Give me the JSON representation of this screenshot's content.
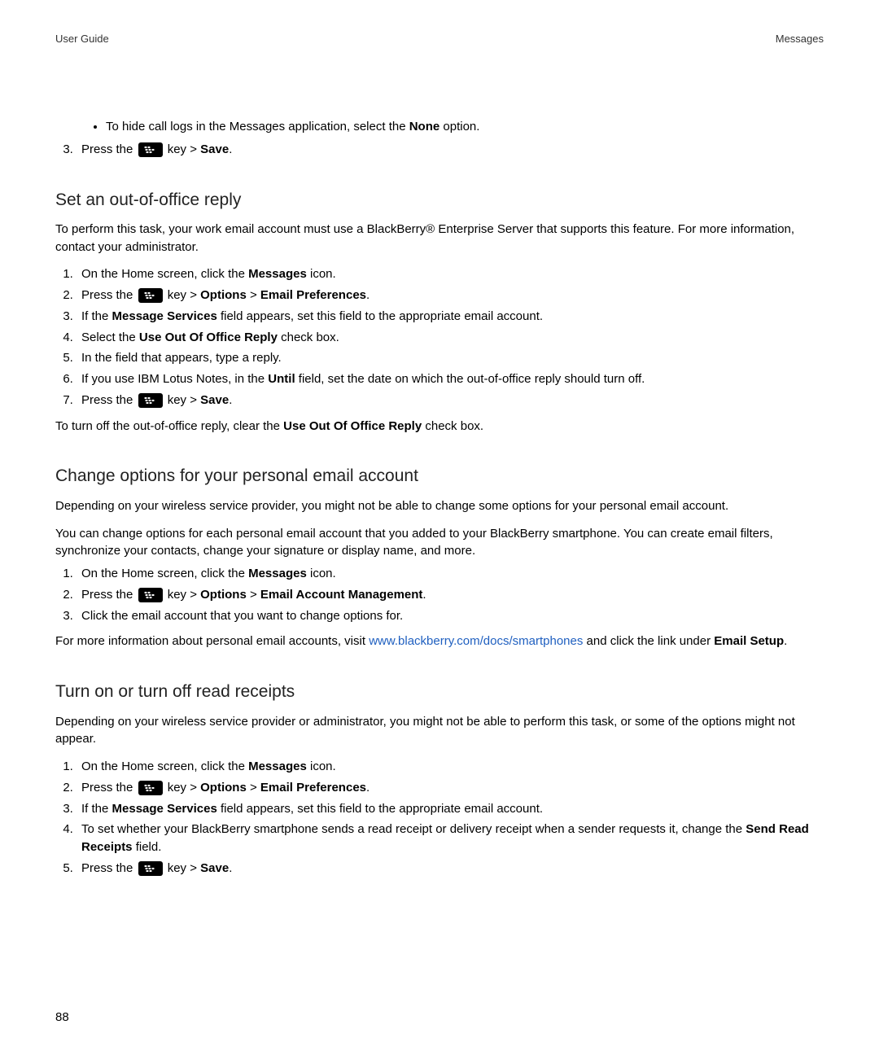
{
  "header": {
    "left": "User Guide",
    "right": "Messages"
  },
  "intro_bullet": {
    "text_before": "To hide call logs in the Messages application, select the ",
    "bold": "None",
    "text_after": " option."
  },
  "intro_step3": {
    "before": "Press the ",
    "after_key": " key > ",
    "save": "Save",
    "period": "."
  },
  "section1": {
    "heading": "Set an out-of-office reply",
    "intro": "To perform this task, your work email account must use a BlackBerry® Enterprise Server that supports this feature. For more information, contact your administrator.",
    "steps": {
      "s1_a": "On the Home screen, click the ",
      "s1_b": "Messages",
      "s1_c": " icon.",
      "s2_a": "Press the ",
      "s2_b": " key > ",
      "s2_c": "Options",
      "s2_d": " > ",
      "s2_e": "Email Preferences",
      "s2_f": ".",
      "s3_a": "If the ",
      "s3_b": "Message Services",
      "s3_c": " field appears, set this field to the appropriate email account.",
      "s4_a": "Select the ",
      "s4_b": "Use Out Of Office Reply",
      "s4_c": " check box.",
      "s5": "In the field that appears, type a reply.",
      "s6_a": "If you use IBM Lotus Notes, in the ",
      "s6_b": "Until",
      "s6_c": " field, set the date on which the out-of-office reply should turn off.",
      "s7_a": "Press the ",
      "s7_b": " key > ",
      "s7_c": "Save",
      "s7_d": "."
    },
    "outro_a": "To turn off the out-of-office reply, clear the ",
    "outro_b": "Use Out Of Office Reply",
    "outro_c": " check box."
  },
  "section2": {
    "heading": "Change options for your personal email account",
    "p1": "Depending on your wireless service provider, you might not be able to change some options for your personal email account.",
    "p2": "You can change options for each personal email account that you added to your BlackBerry smartphone. You can create email filters, synchronize your contacts, change your signature or display name, and more.",
    "steps": {
      "s1_a": "On the Home screen, click the ",
      "s1_b": "Messages",
      "s1_c": " icon.",
      "s2_a": "Press the ",
      "s2_b": " key > ",
      "s2_c": "Options",
      "s2_d": " > ",
      "s2_e": "Email Account Management",
      "s2_f": ".",
      "s3": "Click the email account that you want to change options for."
    },
    "outro_a": "For more information about personal email accounts, visit ",
    "outro_link": "www.blackberry.com/docs/smartphones",
    "outro_b": " and click the link under ",
    "outro_c": "Email Setup",
    "outro_d": "."
  },
  "section3": {
    "heading": "Turn on or turn off read receipts",
    "p1": "Depending on your wireless service provider or administrator, you might not be able to perform this task, or some of the options might not appear.",
    "steps": {
      "s1_a": "On the Home screen, click the ",
      "s1_b": "Messages",
      "s1_c": " icon.",
      "s2_a": "Press the ",
      "s2_b": " key > ",
      "s2_c": "Options",
      "s2_d": " > ",
      "s2_e": "Email Preferences",
      "s2_f": ".",
      "s3_a": "If the ",
      "s3_b": "Message Services",
      "s3_c": " field appears, set this field to the appropriate email account.",
      "s4_a": "To set whether your BlackBerry smartphone sends a read receipt or delivery receipt when a sender requests it, change the ",
      "s4_b": "Send Read Receipts",
      "s4_c": " field.",
      "s5_a": "Press the ",
      "s5_b": " key > ",
      "s5_c": "Save",
      "s5_d": "."
    }
  },
  "page_number": "88"
}
